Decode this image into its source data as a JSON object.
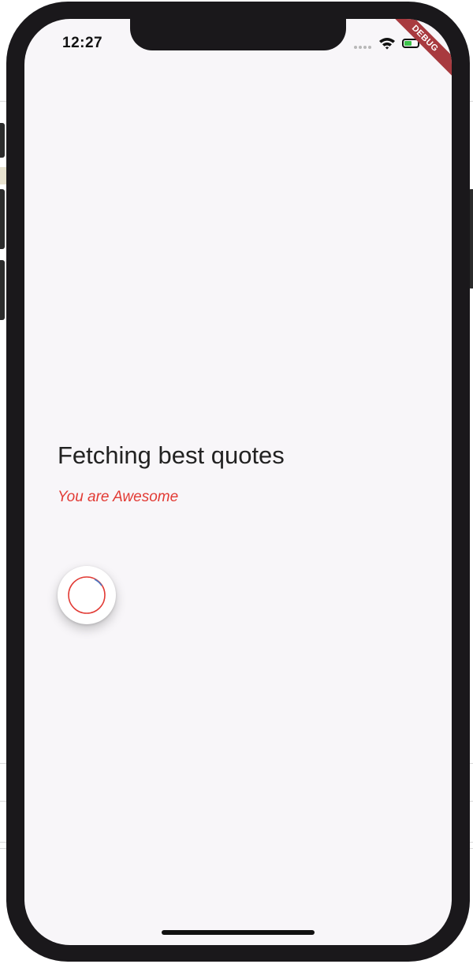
{
  "status_bar": {
    "time": "12:27"
  },
  "debug_banner": {
    "label": "DEBUG"
  },
  "content": {
    "title": "Fetching best quotes",
    "subtitle": "You are Awesome"
  },
  "colors": {
    "accent": "#e23b35",
    "debug_ribbon": "#a83a3f",
    "screen_background": "#f8f6f9",
    "battery": "#3cc24a"
  },
  "icons": {
    "wifi": "wifi-icon",
    "battery": "battery-icon",
    "signal": "signal-icon",
    "loader": "progress-spinner-icon"
  }
}
